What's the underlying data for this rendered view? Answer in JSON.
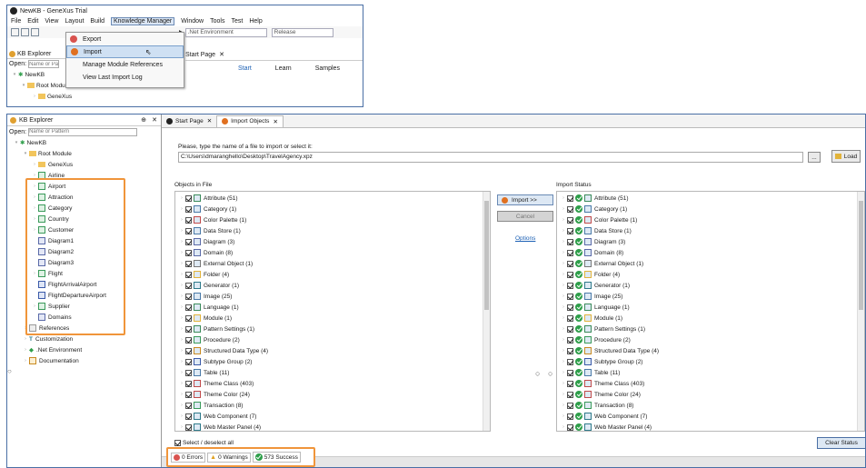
{
  "top": {
    "title": "NewKB - GeneXus Trial",
    "menu": [
      "File",
      "Edit",
      "View",
      "Layout",
      "Build",
      "Knowledge Manager",
      "Window",
      "Tools",
      "Test",
      "Help"
    ],
    "env_combo": ".Net Environment",
    "release_combo": "Release",
    "dropdown": {
      "export": "Export",
      "import": "Import",
      "manage": "Manage Module References",
      "view_log": "View Last Import Log"
    },
    "kb_explorer_tab": "KB Explorer",
    "open_label": "Open:",
    "open_placeholder": "Name or Pa",
    "tree": [
      "NewKB",
      "Root Module",
      "GeneXus"
    ],
    "start_tab": "Start Page",
    "start_links": [
      "Start",
      "Learn",
      "Samples"
    ]
  },
  "kb": {
    "title": "KB Explorer",
    "open_label": "Open:",
    "open_placeholder": "Name or Pattern",
    "root": "NewKB",
    "module": "Root Module",
    "objects": [
      "GeneXus",
      "Airline",
      "Airport",
      "Attraction",
      "Category",
      "Country",
      "Customer",
      "Diagram1",
      "Diagram2",
      "Diagram3",
      "Flight",
      "FlightArrivalAirport",
      "FlightDepartureAirport",
      "Supplier",
      "Domains"
    ],
    "bottom": [
      "References",
      "Customization",
      ".Net Environment",
      "Documentation"
    ]
  },
  "main": {
    "tabs": [
      "Start Page",
      "Import Objects"
    ],
    "prompt": "Please, type the name of a file to import or select it:",
    "file_path": "C:\\Users\\dmaranghello\\Desktop\\TravelAgency.xpz",
    "browse": "...",
    "load": "Load",
    "objects_label": "Objects in File",
    "status_label": "Import Status",
    "items": [
      "Attribute (51)",
      "Category (1)",
      "Color Palette (1)",
      "Data Store (1)",
      "Diagram (3)",
      "Domain (8)",
      "External Object (1)",
      "Folder (4)",
      "Generator (1)",
      "Image (25)",
      "Language (1)",
      "Module (1)",
      "Pattern Settings (1)",
      "Procedure (2)",
      "Structured Data Type (4)",
      "Subtype Group (2)",
      "Table (11)",
      "Theme Class (403)",
      "Theme Color (24)",
      "Transaction (8)",
      "Web Component (7)",
      "Web Master Panel (4)"
    ],
    "import_btn": "Import >>",
    "cancel_btn": "Cancel",
    "options_link": "Options",
    "select_all": "Select / deselect all",
    "clear_status": "Clear Status",
    "errors": "0 Errors",
    "warnings": "0 Warnings",
    "success": "573 Success"
  },
  "colors": {
    "highlight": "#f0953a",
    "frame": "#4a6fa5",
    "ok": "#2e9e4a",
    "link": "#1a5fb4"
  }
}
